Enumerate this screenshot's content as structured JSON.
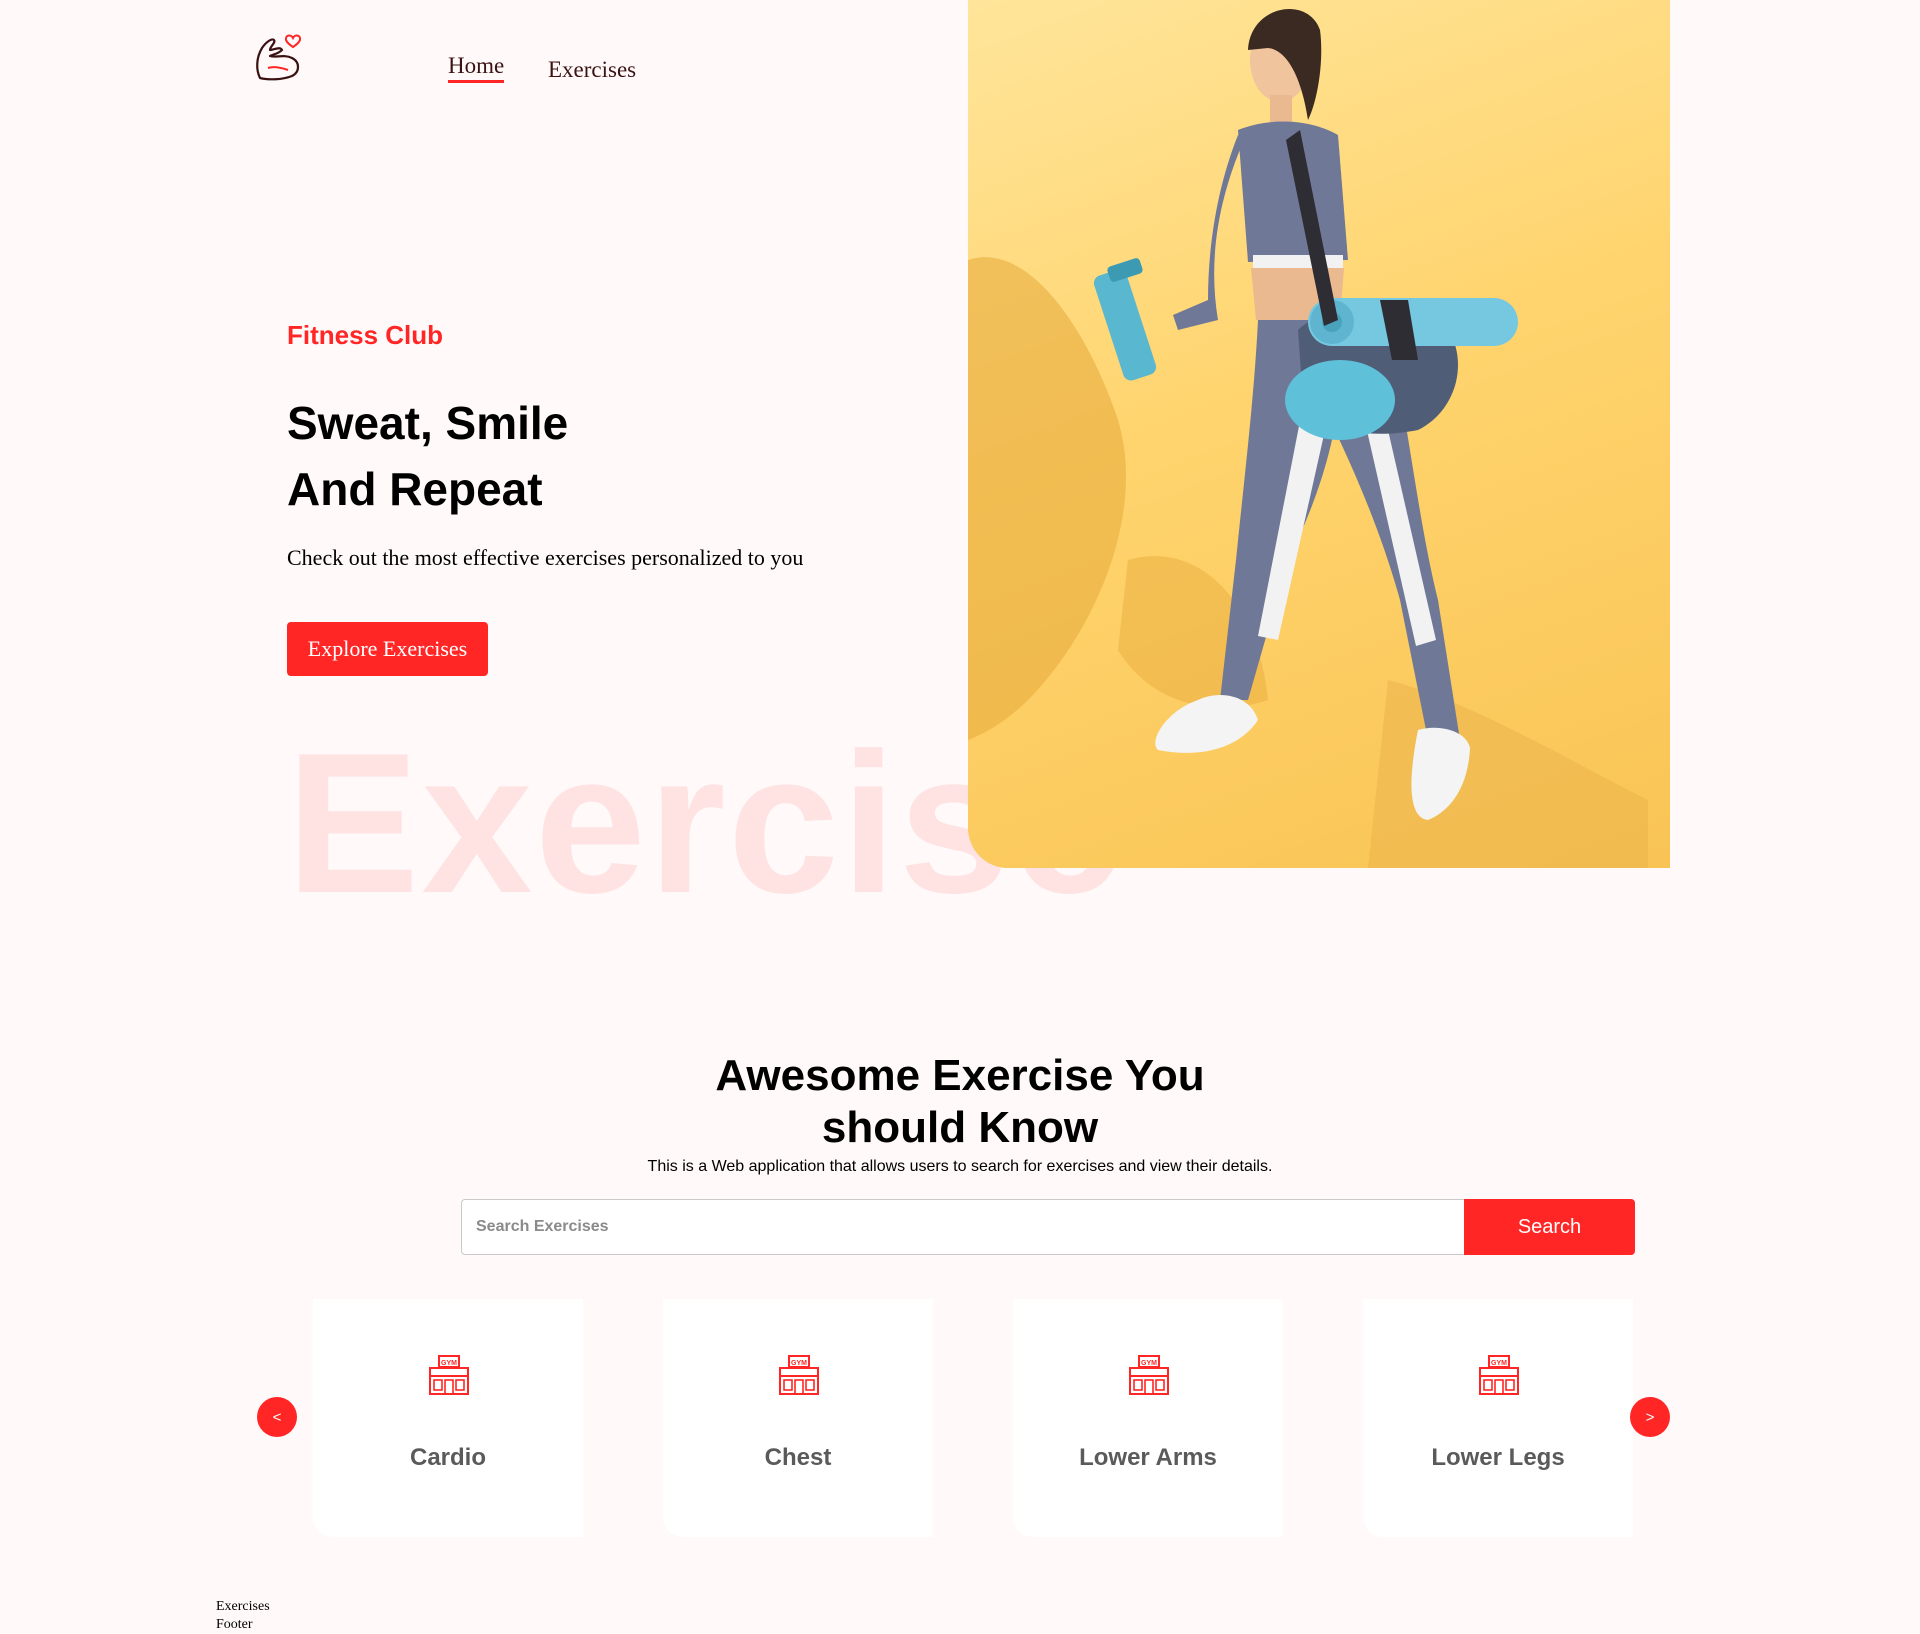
{
  "nav": {
    "logo_icon": "flexed-arm-heart-icon",
    "items": [
      {
        "label": "Home",
        "active": true
      },
      {
        "label": "Exercises",
        "active": false
      }
    ]
  },
  "hero": {
    "subtitle": "Fitness Club",
    "title_line1": "Sweat, Smile",
    "title_line2": "And Repeat",
    "description": "Check out the most effective exercises personalized to you",
    "cta_label": "Explore Exercises",
    "watermark": "Exercise",
    "banner_image": "woman-walking-with-gym-bag-and-shaker-photo"
  },
  "search": {
    "title_line1": "Awesome Exercise You",
    "title_line2": "should Know",
    "description": "This is a Web application that allows users to search for exercises and view their details.",
    "placeholder": "Search Exercises",
    "value": "",
    "button_label": "Search"
  },
  "categories": {
    "prev_label": "<",
    "next_label": ">",
    "icon": "gym-building-icon",
    "items": [
      {
        "label": "Cardio"
      },
      {
        "label": "Chest"
      },
      {
        "label": "Lower Arms"
      },
      {
        "label": "Lower Legs"
      }
    ]
  },
  "footer": {
    "line1": "Exercises",
    "line2": "Footer"
  },
  "colors": {
    "accent": "#ff2625",
    "background": "#fff9f9",
    "banner_yellow": "#ffd46e",
    "card_text": "#5a5a5a"
  }
}
